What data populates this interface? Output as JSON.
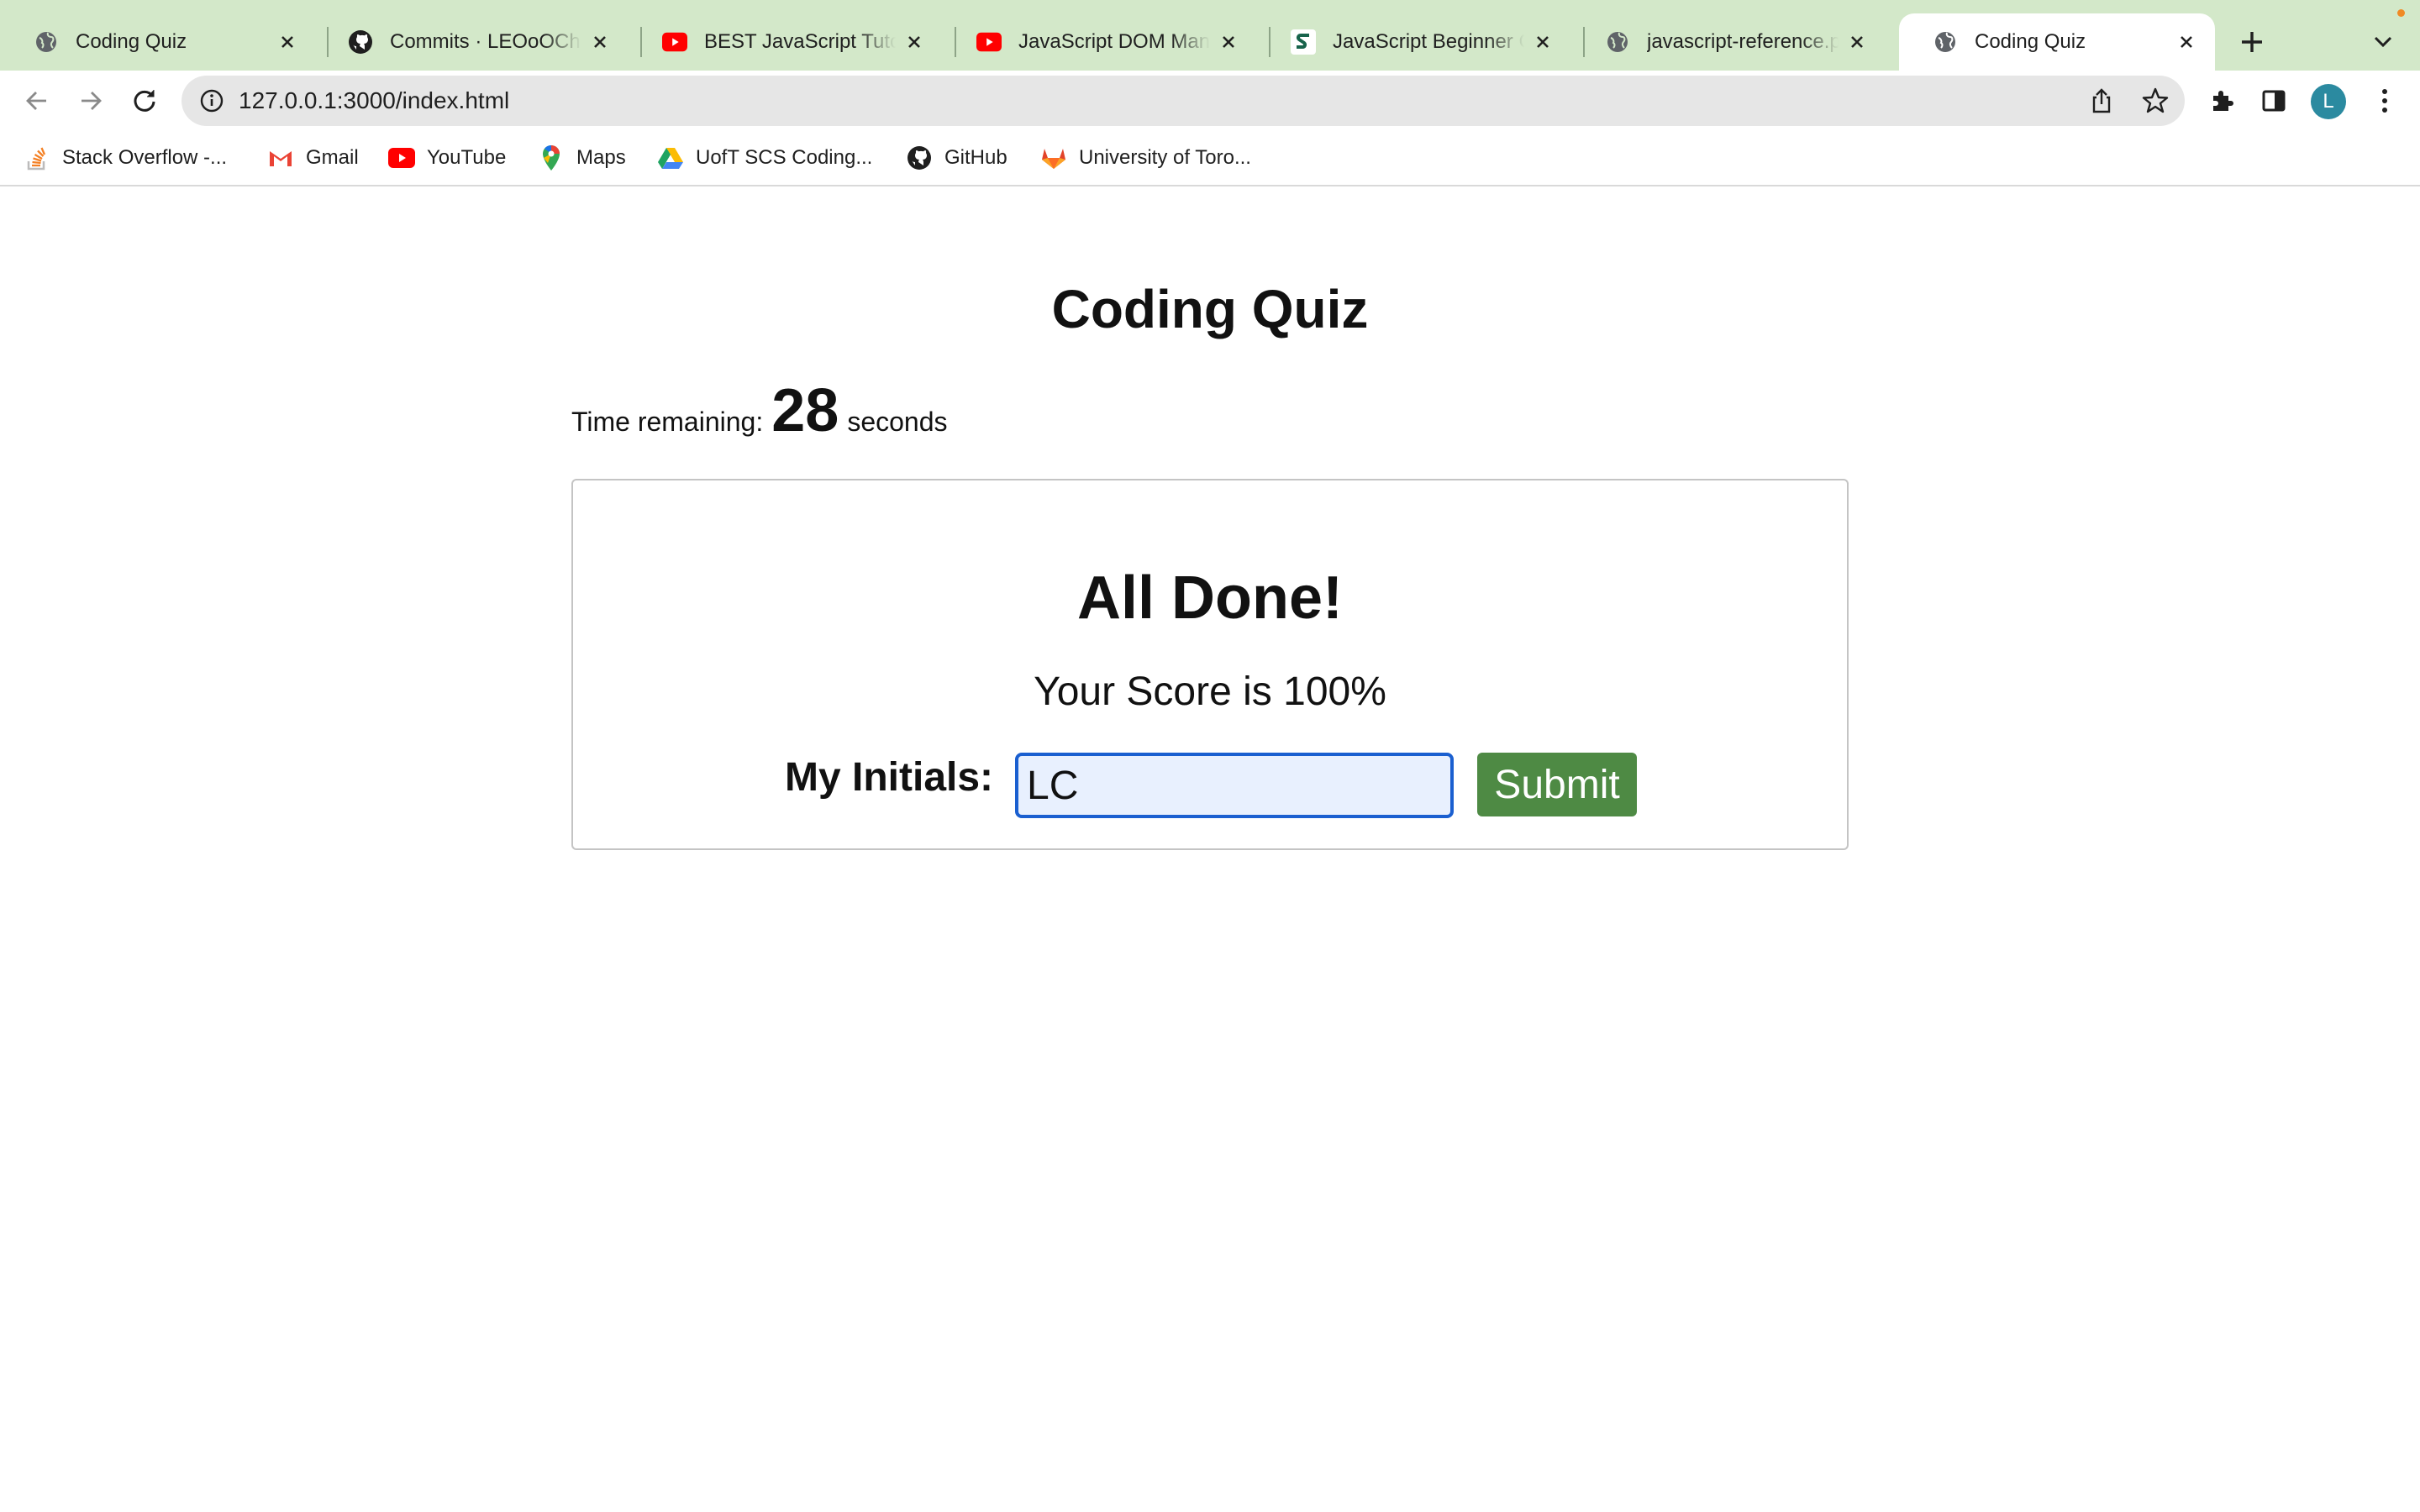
{
  "browser": {
    "tabs": [
      {
        "title": "Coding Quiz",
        "icon": "globe-icon",
        "active": false
      },
      {
        "title": "Commits · LEOoOChan",
        "icon": "github-icon",
        "active": false
      },
      {
        "title": "BEST JavaScript Tutorial",
        "icon": "youtube-icon",
        "active": false
      },
      {
        "title": "JavaScript DOM Manipulation",
        "icon": "youtube-icon",
        "active": false
      },
      {
        "title": "JavaScript Beginner Course",
        "icon": "s-logo-icon",
        "active": false
      },
      {
        "title": "javascript-reference.pdf",
        "icon": "globe-icon",
        "active": false
      },
      {
        "title": "Coding Quiz",
        "icon": "globe-icon",
        "active": true
      }
    ],
    "url": "127.0.0.1:3000/index.html",
    "profile_initial": "L",
    "bookmarks": [
      {
        "label": "Stack Overflow -...",
        "icon": "stackoverflow-icon"
      },
      {
        "label": "Gmail",
        "icon": "gmail-icon"
      },
      {
        "label": "YouTube",
        "icon": "youtube-icon"
      },
      {
        "label": "Maps",
        "icon": "maps-pin-icon"
      },
      {
        "label": "UofT SCS Coding...",
        "icon": "drive-icon"
      },
      {
        "label": "GitHub",
        "icon": "github-icon"
      },
      {
        "label": "University of Toro...",
        "icon": "gitlab-icon"
      }
    ]
  },
  "page": {
    "title": "Coding Quiz",
    "timer": {
      "prefix": "Time remaining:",
      "seconds": "28",
      "suffix": "seconds"
    },
    "result": {
      "heading": "All Done!",
      "score_text": "Your Score is 100%",
      "initials_label": "My Initials:",
      "initials_value": "LC",
      "submit_label": "Submit"
    }
  },
  "colors": {
    "tabstrip_bg": "#d3e8c9",
    "submit_bg": "#4e8a44",
    "input_focus_border": "#1a5fd0",
    "avatar_bg": "#2b8aa0"
  }
}
